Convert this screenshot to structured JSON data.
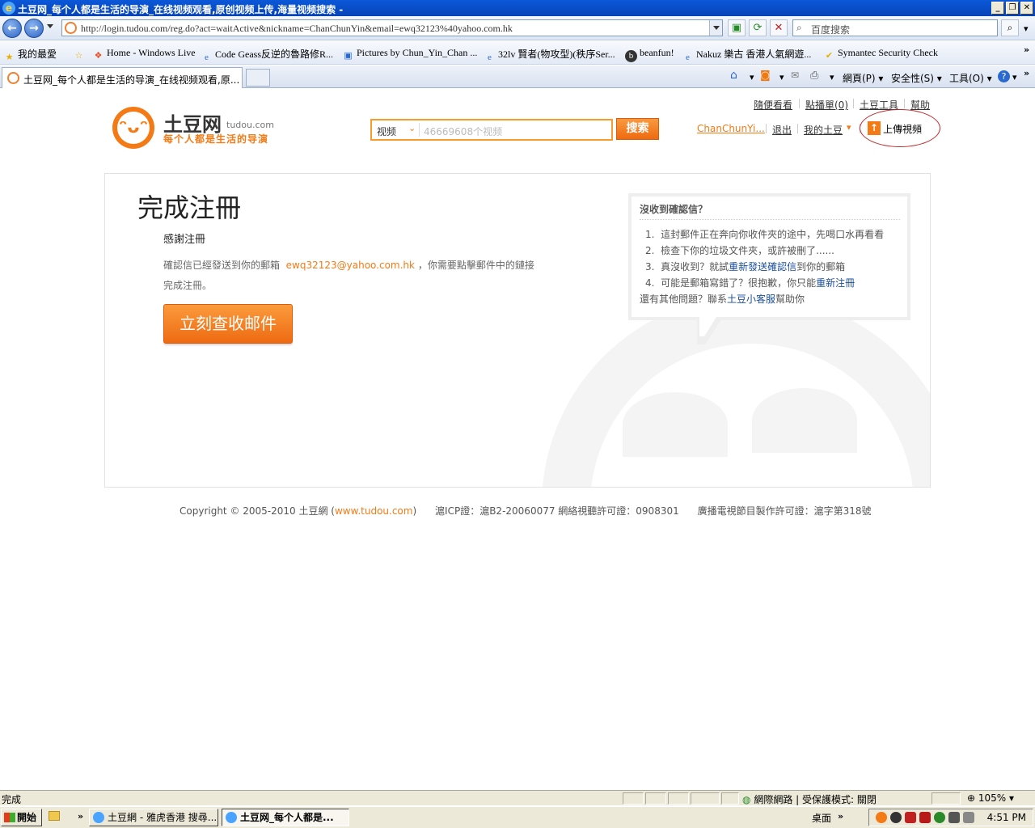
{
  "window": {
    "title": "土豆网_每个人都是生活的导演_在线视频观看,原创视频上传,海量视频搜索 -",
    "minimize": "_",
    "maximize": "❐",
    "close": "✕"
  },
  "address_bar": {
    "url": "http://login.tudou.com/reg.do?act=waitActive&nickname=ChanChunYin&email=ewq32123%40yahoo.com.hk",
    "search_placeholder": "百度搜索"
  },
  "favorites_bar": {
    "favorites_label": "我的最愛",
    "items": [
      "Home - Windows Live",
      "Code Geass反逆的魯路修R...",
      "Pictures by Chun_Yin_Chan ...",
      "32lv 賢者(物攻型)(秩序Ser...",
      "beanfun!",
      "Nakuz 樂古 香港人氣網遊...",
      "Symantec Security Check"
    ]
  },
  "tab_bar": {
    "active_tab": "土豆网_每个人都是生活的导演_在线视频观看,原...",
    "commands": {
      "page": "網頁(P)",
      "safety": "安全性(S)",
      "tools": "工具(O)"
    }
  },
  "site_header": {
    "logo_name": "土豆网",
    "logo_domain": "tudou.com",
    "slogan": "每个人都是生活的导演",
    "search_category": "视频",
    "search_placeholder": "46669608个视频",
    "search_button": "搜索",
    "top_links": [
      "隨便看看",
      "點播單(0)",
      "土豆工具",
      "幫助"
    ],
    "username": "ChanChunYi...",
    "logout": "退出",
    "my_tudou": "我的土豆",
    "upload": "上傳視頻"
  },
  "main": {
    "title": "完成注冊",
    "thanks": "感謝注冊",
    "confirm_prefix": "確認信已經發送到你的郵箱",
    "email": "ewq32123@yahoo.com.hk",
    "confirm_suffix": "，你需要點擊郵件中的鏈接完成注冊。",
    "check_mail_button": "立刻查收邮件"
  },
  "help": {
    "title": "沒收到確認信？",
    "items": [
      {
        "num": "1.",
        "text_a": "這封郵件正在奔向你收件夾的途中，先喝口水再看看",
        "link": "",
        "text_b": ""
      },
      {
        "num": "2.",
        "text_a": "檢查下你的垃圾文件夾，或許被刪了......",
        "link": "",
        "text_b": ""
      },
      {
        "num": "3.",
        "text_a": "真沒收到？就試",
        "link": "重新發送確認信",
        "text_b": "到你的郵箱"
      },
      {
        "num": "4.",
        "text_a": "可能是郵箱寫錯了？很抱歉，你只能",
        "link": "重新注冊",
        "text_b": ""
      }
    ],
    "extra_prefix": "還有其他問題？聯系",
    "extra_link": "土豆小客服",
    "extra_suffix": "幫助你"
  },
  "footer": {
    "copyright": "Copyright © 2005-2010 土豆網 (",
    "site_link": "www.tudou.com",
    "close_paren": ")",
    "icp": "滬ICP證：滬B2-20060077 網絡視聽許可證：0908301",
    "broadcast": "廣播電視節目製作許可證：滬字第318號"
  },
  "status_bar": {
    "status": "完成",
    "zone": "網際網路 | 受保護模式: 關閉",
    "zoom": "105%"
  },
  "taskbar": {
    "start": "開始",
    "tasks": [
      "土豆網 - 雅虎香港 搜尋...",
      "土豆网_每个人都是..."
    ],
    "desktop": "桌面",
    "clock": "4:51 PM"
  },
  "colors": {
    "brand_orange": "#f47a16",
    "link_blue": "#1a4f9c",
    "annotation_red": "#c0282a"
  }
}
